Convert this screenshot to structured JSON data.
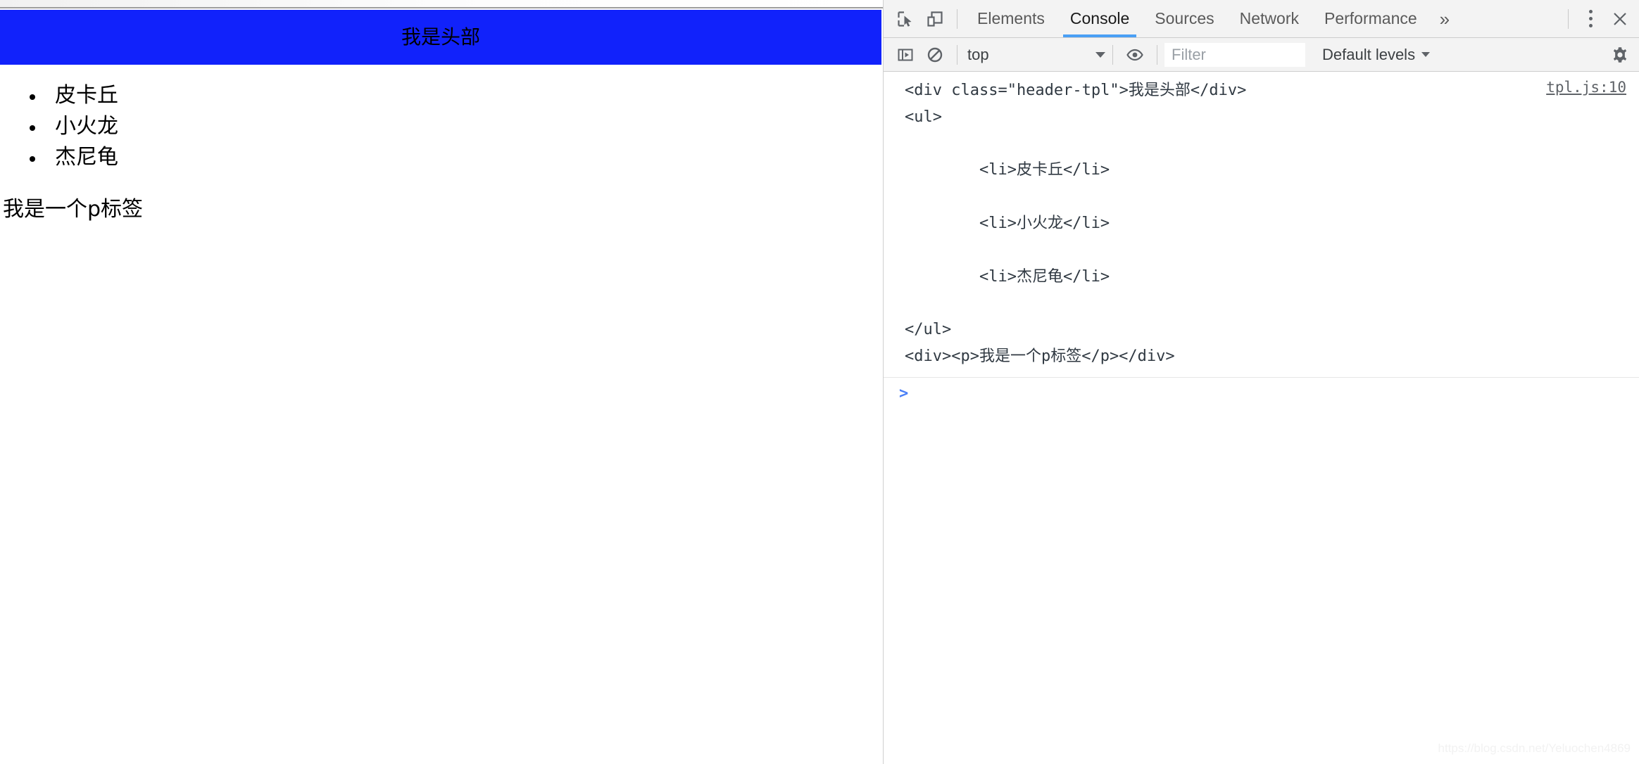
{
  "page": {
    "header_text": "我是头部",
    "header_bg": "#1122fb",
    "list_items": [
      {
        "label": "皮卡丘"
      },
      {
        "label": "小火龙"
      },
      {
        "label": "杰尼龟"
      }
    ],
    "paragraph": "我是一个p标签"
  },
  "devtools": {
    "tabs": [
      {
        "label": "Elements",
        "active": false
      },
      {
        "label": "Console",
        "active": true
      },
      {
        "label": "Sources",
        "active": false
      },
      {
        "label": "Network",
        "active": false
      },
      {
        "label": "Performance",
        "active": false
      }
    ],
    "more_tabs_label": "»",
    "accent_color": "#4a9ff5",
    "icons": {
      "inspect": "inspect-element-icon",
      "device": "device-toolbar-icon",
      "kebab": "more-options-icon",
      "close": "close-devtools-icon",
      "sidebar": "console-sidebar-icon",
      "clear": "clear-console-icon",
      "eye": "live-expression-icon",
      "settings": "settings-gear-icon"
    },
    "toolbar": {
      "context_value": "top",
      "filter_placeholder": "Filter",
      "filter_value": "",
      "levels_label": "Default levels"
    },
    "console": {
      "message": "<div class=\"header-tpl\">我是头部</div>\n<ul>\n\n        <li>皮卡丘</li>\n\n        <li>小火龙</li>\n\n        <li>杰尼龟</li>\n\n</ul>\n<div><p>我是一个p标签</p></div>",
      "source_link": "tpl.js:10",
      "prompt_symbol": ">"
    }
  },
  "watermark": "https://blog.csdn.net/Yeluochen4869"
}
